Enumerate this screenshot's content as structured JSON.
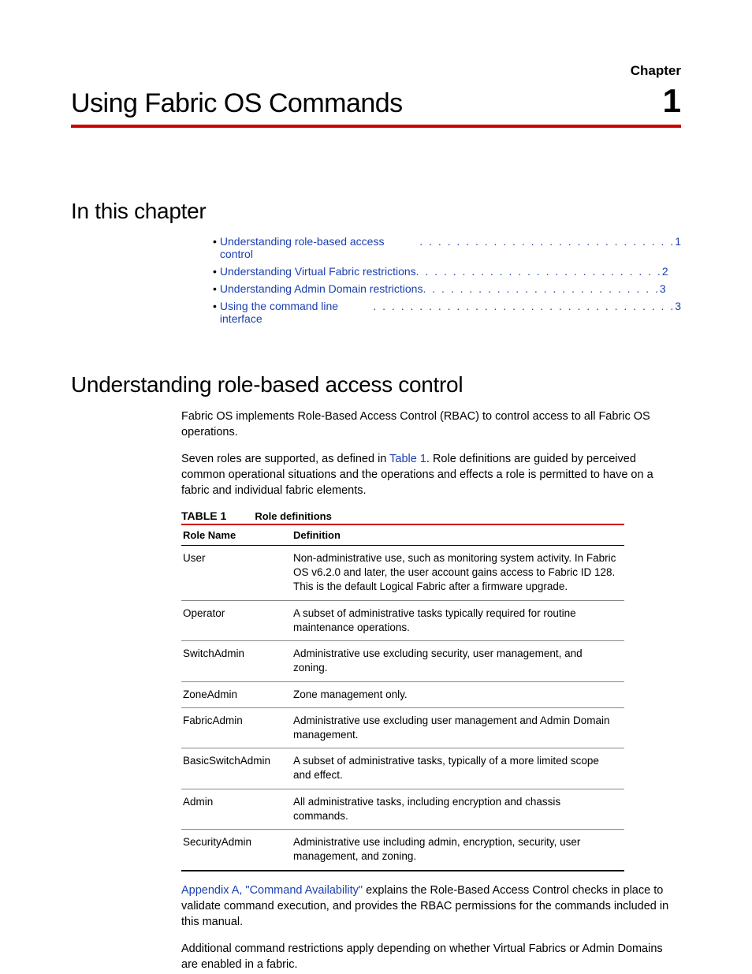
{
  "header": {
    "chapter_label": "Chapter",
    "chapter_title": "Using Fabric OS Commands",
    "chapter_number": "1"
  },
  "sections": {
    "in_this_chapter": "In this chapter",
    "understanding_rbac": "Understanding role-based access control"
  },
  "toc": [
    {
      "text": "Understanding role-based access control",
      "dots": " . . . . . . . . . . . . . . . . . . . . . . . . . . . .  ",
      "page": "1"
    },
    {
      "text": "Understanding Virtual Fabric restrictions ",
      "dots": " . . . . . . . . . . . . . . . . . . . . . . . . . . .  ",
      "page": "2"
    },
    {
      "text": "Understanding Admin Domain restrictions",
      "dots": " . . . . . . . . . . . . . . . . . . . . . . . . . .  ",
      "page": "3"
    },
    {
      "text": "Using the command line interface",
      "dots": " . . . . . . . . . . . . . . . . . . . . . . . . . . . . . . . . .  ",
      "page": "3"
    }
  ],
  "body": {
    "p1": "Fabric OS implements Role-Based Access Control (RBAC) to control access to all Fabric OS operations.",
    "p2a": "Seven roles are supported, as defined in ",
    "p2_link": "Table 1",
    "p2b": ". Role definitions are guided by perceived common operational situations and the operations and effects a role is permitted to have on a fabric and individual fabric elements.",
    "p3_link": "Appendix A, \"Command Availability\"",
    "p3": " explains the Role-Based Access Control checks in place to validate command execution, and provides the RBAC permissions for the commands included in this manual.",
    "p4": "Additional command restrictions apply depending on whether Virtual Fabrics or Admin Domains are enabled in a fabric."
  },
  "table": {
    "label": "TABLE 1",
    "name": "Role definitions",
    "headers": {
      "role": "Role Name",
      "definition": "Definition"
    },
    "rows": [
      {
        "role": "User",
        "definition": "Non-administrative use, such as monitoring system activity. In Fabric OS v6.2.0 and later, the user account gains access to Fabric ID 128. This is the default Logical Fabric after a firmware upgrade."
      },
      {
        "role": "Operator",
        "definition": "A subset of administrative tasks typically required for routine maintenance operations."
      },
      {
        "role": "SwitchAdmin",
        "definition": "Administrative use excluding security, user management, and zoning."
      },
      {
        "role": "ZoneAdmin",
        "definition": "Zone management only."
      },
      {
        "role": "FabricAdmin",
        "definition": "Administrative use excluding user management and Admin Domain management."
      },
      {
        "role": "BasicSwitchAdmin",
        "definition": "A subset of administrative tasks, typically of a more limited scope and effect."
      },
      {
        "role": "Admin",
        "definition": "All administrative tasks, including encryption and chassis commands."
      },
      {
        "role": "SecurityAdmin",
        "definition": "Administrative use including admin, encryption, security, user management, and zoning."
      }
    ]
  }
}
